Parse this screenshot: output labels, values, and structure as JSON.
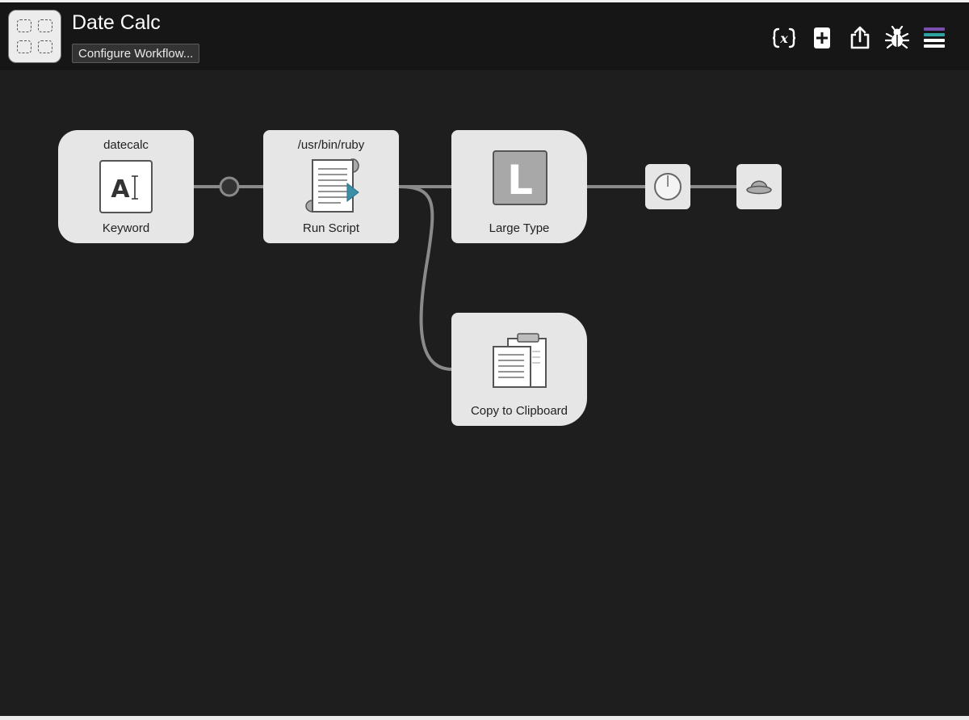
{
  "header": {
    "title": "Date Calc",
    "configure_label": "Configure Workflow..."
  },
  "toolbar": {
    "icons": [
      "variables-icon",
      "add-object-icon",
      "export-icon",
      "debug-icon",
      "menu-icon"
    ]
  },
  "colors": {
    "background": "#1e1e1e",
    "header": "#161616",
    "node": "#e6e6e6",
    "wire": "#8a8a8a",
    "accent_teal": "#3a8fa6",
    "menu_purple": "#7b4fb0",
    "menu_teal": "#2ea3a3"
  },
  "nodes": {
    "keyword": {
      "top": "datecalc",
      "bottom": "Keyword"
    },
    "run_script": {
      "top": "/usr/bin/ruby",
      "bottom": "Run Script"
    },
    "large_type": {
      "bottom": "Large Type",
      "glyph": "L"
    },
    "clipboard": {
      "bottom": "Copy to Clipboard"
    }
  }
}
